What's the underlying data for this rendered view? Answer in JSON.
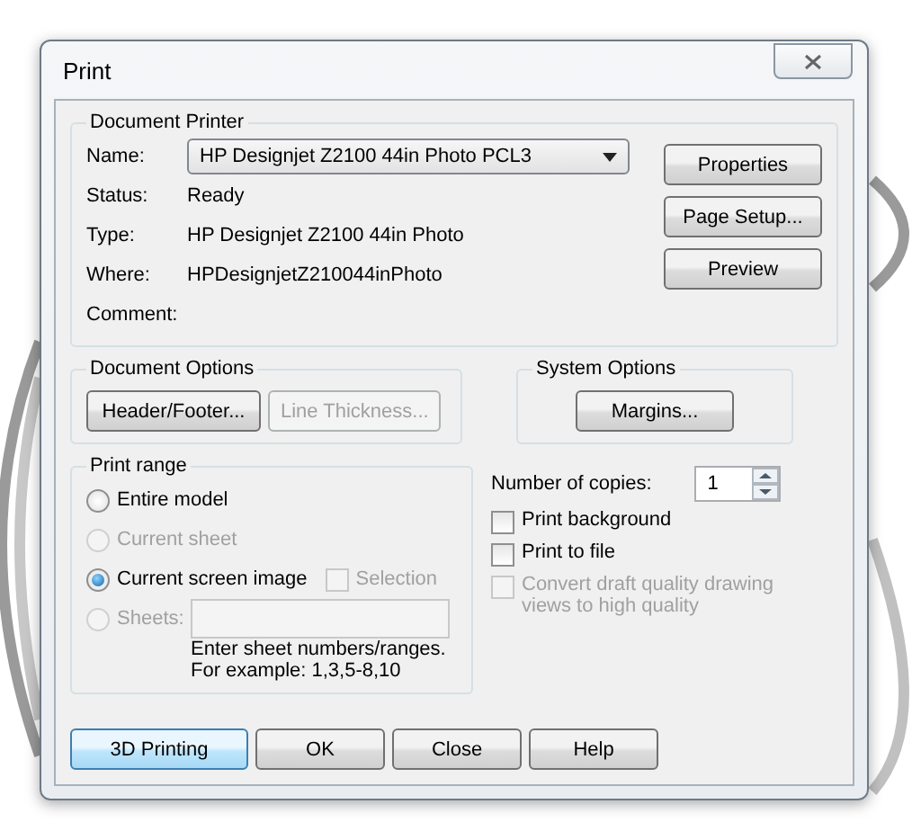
{
  "window": {
    "title": "Print"
  },
  "printer": {
    "title": "Document Printer",
    "fields": [
      {
        "kind": "dropdown",
        "label": "Name:",
        "value": "HP Designjet Z2100 44in Photo PCL3"
      },
      {
        "kind": "text",
        "label": "Status:",
        "value": "Ready"
      },
      {
        "kind": "text",
        "label": "Type:",
        "value": "HP Designjet Z2100 44in Photo"
      },
      {
        "kind": "text",
        "label": "Where:",
        "value": "HPDesignjetZ210044inPhoto"
      },
      {
        "kind": "text",
        "label": "Comment:"
      }
    ],
    "buttons": [
      {
        "label": "Properties",
        "disabled": false
      },
      {
        "label": "Page Setup...",
        "disabled": false
      },
      {
        "label": "Preview",
        "disabled": false
      }
    ]
  },
  "document_options": {
    "title": "Document Options",
    "buttons": [
      {
        "label": "Header/Footer...",
        "disabled": false
      },
      {
        "label": "Line Thickness...",
        "disabled": true
      }
    ]
  },
  "system_options": {
    "title": "System Options",
    "buttons": [
      {
        "label": "Margins...",
        "disabled": false
      }
    ]
  },
  "print_range": {
    "title": "Print range",
    "options": [
      {
        "label": "Entire model",
        "selected": false,
        "disabled": false
      },
      {
        "label": "Current sheet",
        "selected": false,
        "disabled": true
      },
      {
        "label": "Current screen image",
        "selected": true,
        "disabled": false,
        "checkbox": {
          "label": "Selection",
          "checked": false,
          "disabled": true
        }
      },
      {
        "label": "Sheets:",
        "selected": false,
        "disabled": true,
        "field": true
      }
    ],
    "hint_lines": [
      "Enter sheet numbers/ranges.",
      "For example: 1,3,5-8,10"
    ]
  },
  "copies": {
    "label": "Number of copies:",
    "value": "1"
  },
  "checkboxes": [
    {
      "label": "Print background",
      "checked": false,
      "disabled": false
    },
    {
      "label": "Print to file",
      "checked": false,
      "disabled": false
    },
    {
      "label": "Convert draft quality drawing views to high quality",
      "checked": false,
      "disabled": true
    }
  ],
  "buttons": [
    {
      "label": "3D Printing",
      "focused": true
    },
    {
      "label": "OK",
      "focused": false
    },
    {
      "label": "Close",
      "focused": false
    },
    {
      "label": "Help",
      "focused": false
    }
  ]
}
